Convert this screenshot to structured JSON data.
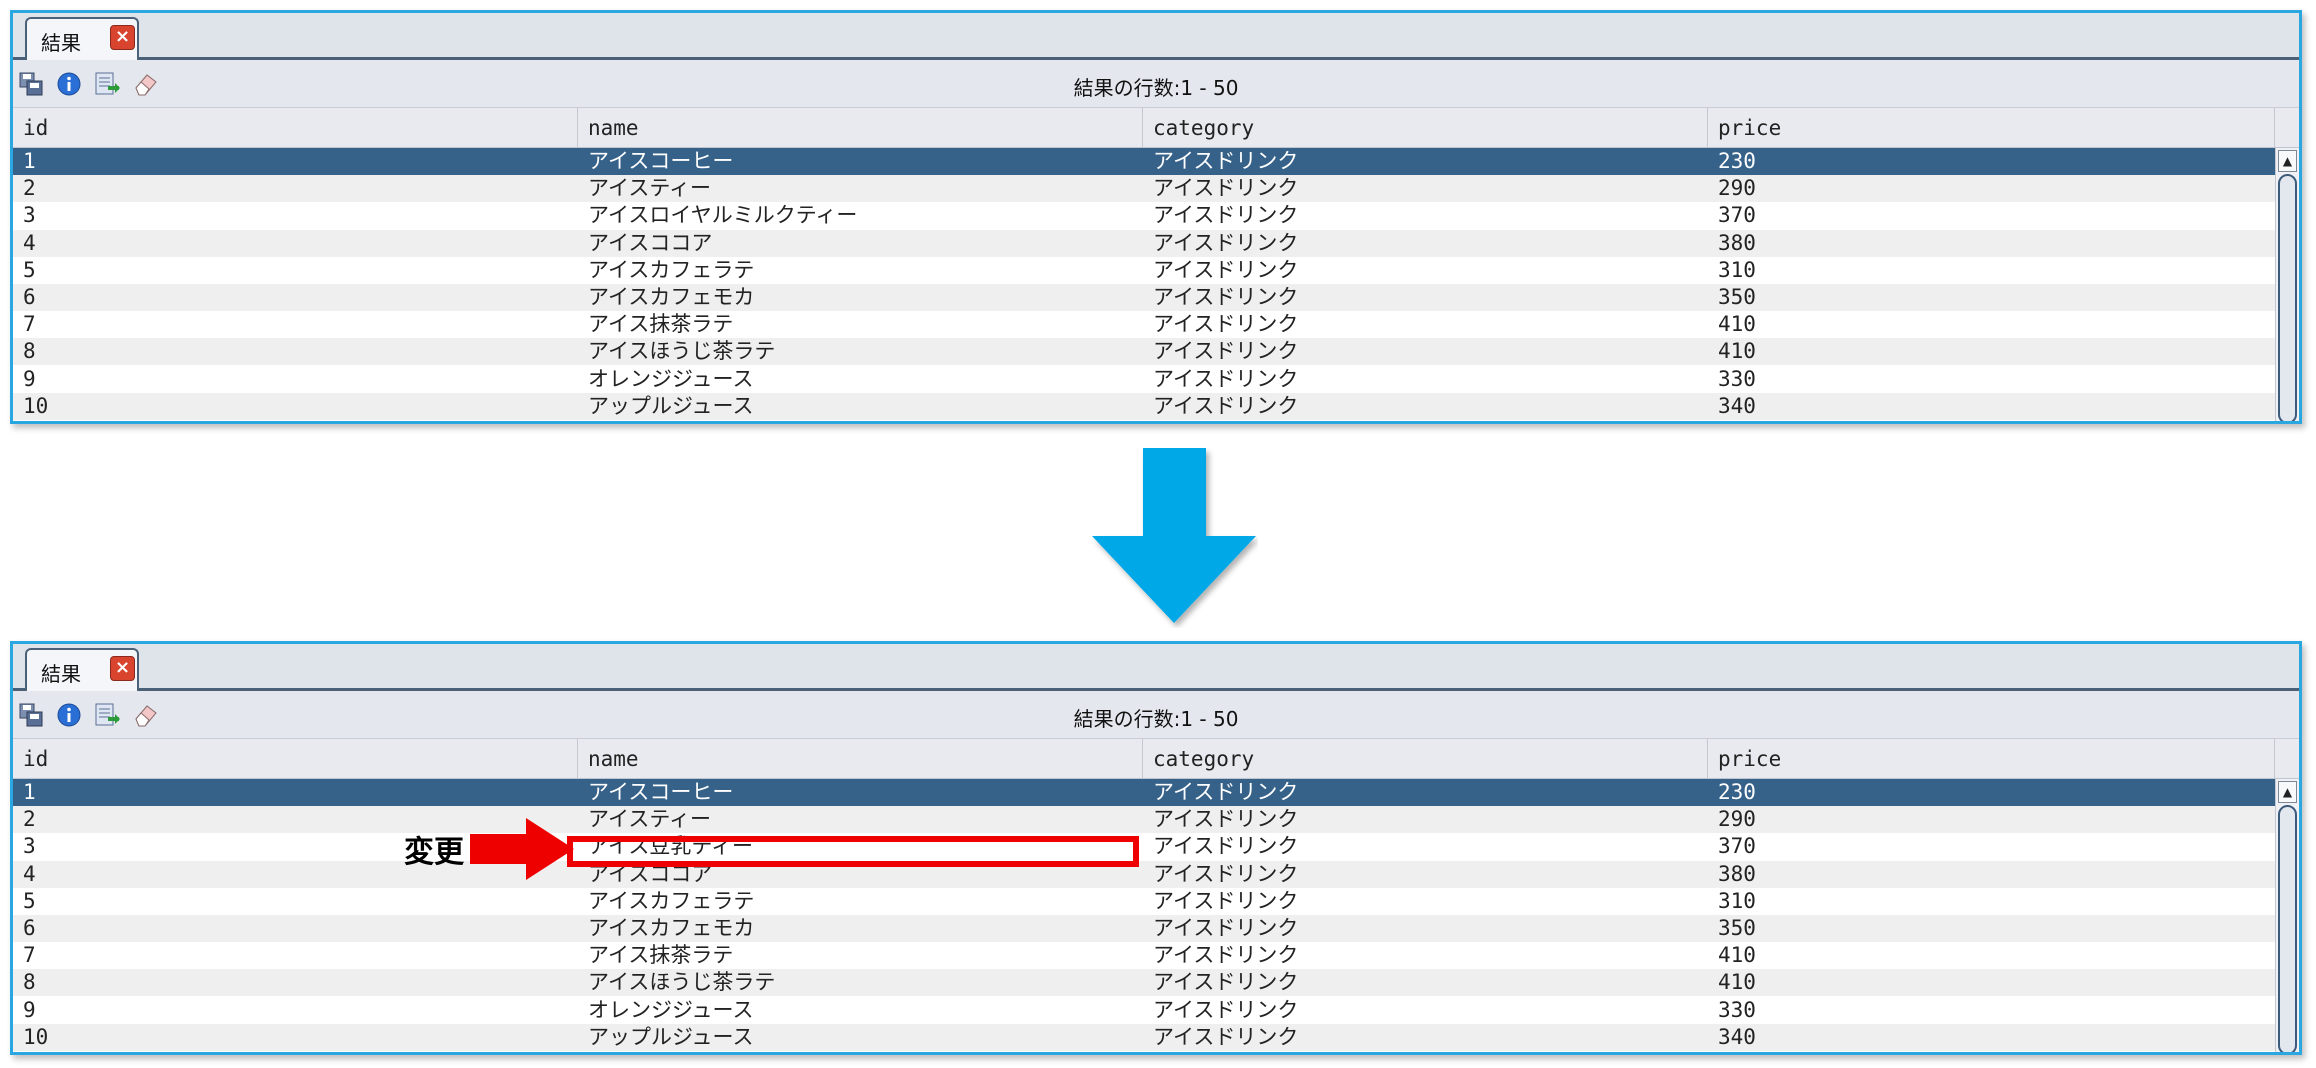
{
  "before": {
    "tab": {
      "label": "結果",
      "close_glyph": "×"
    },
    "toolbar": {
      "result_count": "結果の行数:1 - 50"
    },
    "columns": [
      "id",
      "name",
      "category",
      "price"
    ],
    "rows": [
      [
        "1",
        "アイスコーヒー",
        "アイスドリンク",
        "230"
      ],
      [
        "2",
        "アイスティー",
        "アイスドリンク",
        "290"
      ],
      [
        "3",
        "アイスロイヤルミルクティー",
        "アイスドリンク",
        "370"
      ],
      [
        "4",
        "アイスココア",
        "アイスドリンク",
        "380"
      ],
      [
        "5",
        "アイスカフェラテ",
        "アイスドリンク",
        "310"
      ],
      [
        "6",
        "アイスカフェモカ",
        "アイスドリンク",
        "350"
      ],
      [
        "7",
        "アイス抹茶ラテ",
        "アイスドリンク",
        "410"
      ],
      [
        "8",
        "アイスほうじ茶ラテ",
        "アイスドリンク",
        "410"
      ],
      [
        "9",
        "オレンジジュース",
        "アイスドリンク",
        "330"
      ],
      [
        "10",
        "アップルジュース",
        "アイスドリンク",
        "340"
      ]
    ],
    "selected_row": 0
  },
  "after": {
    "tab": {
      "label": "結果",
      "close_glyph": "×"
    },
    "toolbar": {
      "result_count": "結果の行数:1 - 50"
    },
    "columns": [
      "id",
      "name",
      "category",
      "price"
    ],
    "rows": [
      [
        "1",
        "アイスコーヒー",
        "アイスドリンク",
        "230"
      ],
      [
        "2",
        "アイスティー",
        "アイスドリンク",
        "290"
      ],
      [
        "3",
        "アイス豆乳ティー",
        "アイスドリンク",
        "370"
      ],
      [
        "4",
        "アイスココア",
        "アイスドリンク",
        "380"
      ],
      [
        "5",
        "アイスカフェラテ",
        "アイスドリンク",
        "310"
      ],
      [
        "6",
        "アイスカフェモカ",
        "アイスドリンク",
        "350"
      ],
      [
        "7",
        "アイス抹茶ラテ",
        "アイスドリンク",
        "410"
      ],
      [
        "8",
        "アイスほうじ茶ラテ",
        "アイスドリンク",
        "410"
      ],
      [
        "9",
        "オレンジジュース",
        "アイスドリンク",
        "330"
      ],
      [
        "10",
        "アップルジュース",
        "アイスドリンク",
        "340"
      ]
    ],
    "selected_row": 0
  },
  "annotation": {
    "label": "変更",
    "highlight_row": 2,
    "highlight_column": "name"
  },
  "icons": [
    "save-icon",
    "info-icon",
    "export-icon",
    "eraser-icon"
  ],
  "colors": {
    "panel_border": "#2aa7e0",
    "selected_row": "#36628a",
    "down_arrow": "#00a8e8",
    "annotation": "#ee0000"
  }
}
